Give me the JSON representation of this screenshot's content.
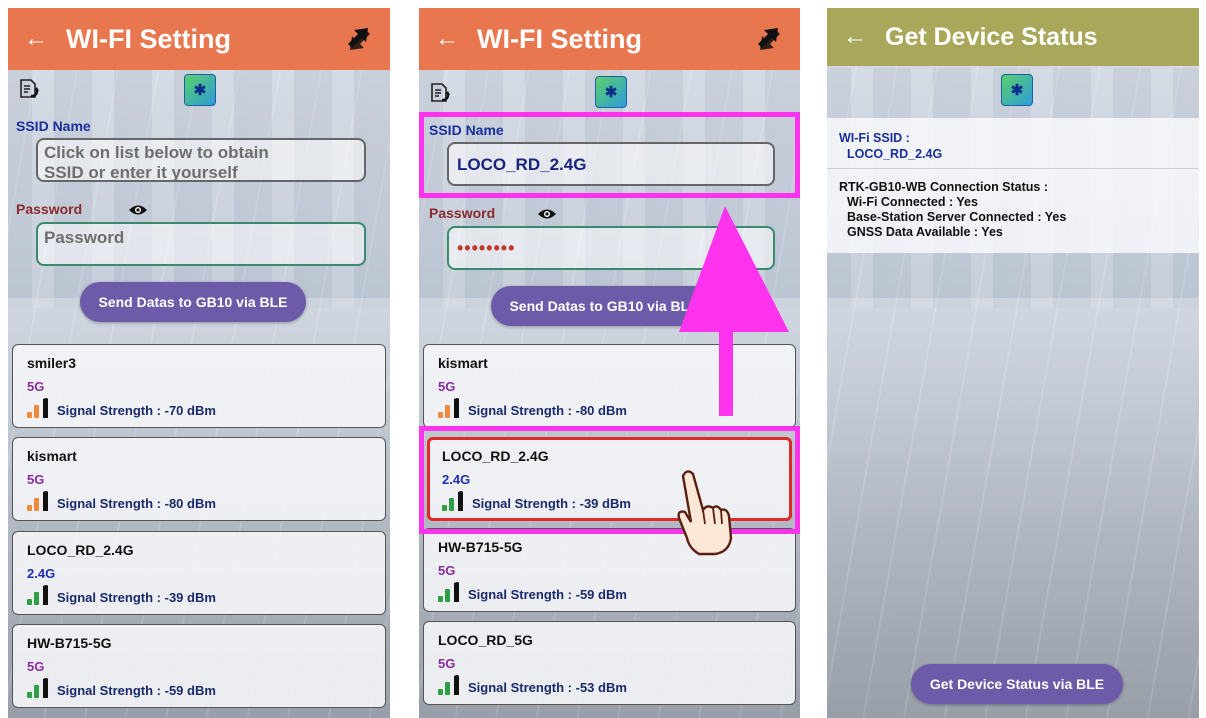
{
  "colors": {
    "appbar_wifi": "#e8774f",
    "appbar_status": "#a9a75a",
    "button": "#6d5aa8",
    "highlight": "#ff33ee",
    "selection": "#e02a2a"
  },
  "screen1": {
    "title": "WI-FI Setting",
    "back_icon": "←",
    "ssid_label": "SSID Name",
    "ssid_placeholder_line1": "Click on list below to obtain",
    "ssid_placeholder_line2": "SSID or enter it yourself",
    "password_label": "Password",
    "password_placeholder": "Password",
    "send_button": "Send Datas to GB10 via BLE",
    "networks": [
      {
        "name": "smiler3",
        "band": "5G",
        "signal": "Signal Strength : -70 dBm",
        "strength": "medium"
      },
      {
        "name": "kismart",
        "band": "5G",
        "signal": "Signal Strength : -80 dBm",
        "strength": "weak"
      },
      {
        "name": "LOCO_RD_2.4G",
        "band": "2.4G",
        "signal": "Signal Strength : -39 dBm",
        "strength": "strong"
      },
      {
        "name": "HW-B715-5G",
        "band": "5G",
        "signal": "Signal Strength : -59 dBm",
        "strength": "strong"
      }
    ]
  },
  "screen2": {
    "title": "WI-FI Setting",
    "back_icon": "←",
    "ssid_label": "SSID Name",
    "ssid_value": "LOCO_RD_2.4G",
    "password_label": "Password",
    "password_value": "••••••••",
    "send_button": "Send Datas to GB10 via BLE",
    "networks": [
      {
        "name": "kismart",
        "band": "5G",
        "signal": "Signal Strength : -80 dBm",
        "strength": "weak"
      },
      {
        "name": "LOCO_RD_2.4G",
        "band": "2.4G",
        "signal": "Signal Strength : -39 dBm",
        "strength": "strong"
      },
      {
        "name": "HW-B715-5G",
        "band": "5G",
        "signal": "Signal Strength : -59 dBm",
        "strength": "strong"
      },
      {
        "name": "LOCO_RD_5G",
        "band": "5G",
        "signal": "Signal Strength : -53 dBm",
        "strength": "strong"
      }
    ]
  },
  "screen3": {
    "title": "Get Device Status",
    "back_icon": "←",
    "wifi_ssid_label": "WI-Fi SSID :",
    "wifi_ssid_value": "LOCO_RD_2.4G",
    "connection_status_label": "RTK-GB10-WB Connection Status :",
    "wifi_connected": "Wi-Fi Connected : Yes",
    "base_station": "Base-Station Server Connected : Yes",
    "gnss": "GNSS Data Available : Yes",
    "button": "Get Device Status via BLE"
  }
}
